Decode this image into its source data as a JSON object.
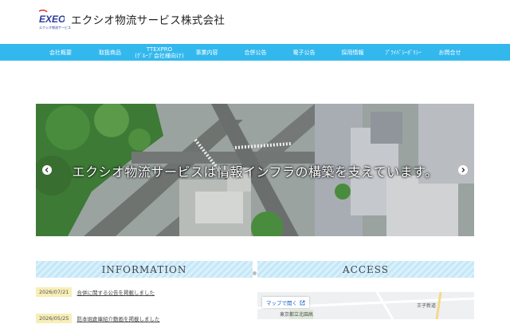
{
  "header": {
    "logo_text": "EXEO",
    "logo_subtext": "エクシオ物流サービス",
    "company_name": "エクシオ物流サービス株式会社"
  },
  "nav": {
    "items": [
      {
        "label": "会社概要"
      },
      {
        "label": "取扱商品"
      },
      {
        "label": "TTEXPRO",
        "sublabel": "(ｸﾞﾙｰﾌﾟ会社様向け)"
      },
      {
        "label": "事業内容"
      },
      {
        "label": "合併公告"
      },
      {
        "label": "電子公告"
      },
      {
        "label": "採用情報"
      },
      {
        "label": "ﾌﾟﾗｲﾊﾞｼｰﾎﾟﾘｼｰ"
      },
      {
        "label": "お問合せ"
      }
    ]
  },
  "hero": {
    "caption": "エクシオ物流サービスは情報インフラの構築を支えています。"
  },
  "sections": {
    "information": "INFORMATION",
    "access": "ACCESS"
  },
  "news": [
    {
      "date": "2026/07/21",
      "title": "合併に関する公告を掲載しました"
    },
    {
      "date": "2026/05/25",
      "title": "防本堀倉庫紹介動画を掲載しました"
    }
  ],
  "map": {
    "open_label": "マップで開く",
    "labels": [
      "東京都立北園高",
      "王子新道"
    ]
  },
  "colors": {
    "nav_bg": "#33b8ee",
    "section_stripe": "#c4e7f8",
    "date_badge": "#f7eeb8",
    "logo_blue": "#2a3a9a",
    "logo_red": "#e03c31"
  }
}
